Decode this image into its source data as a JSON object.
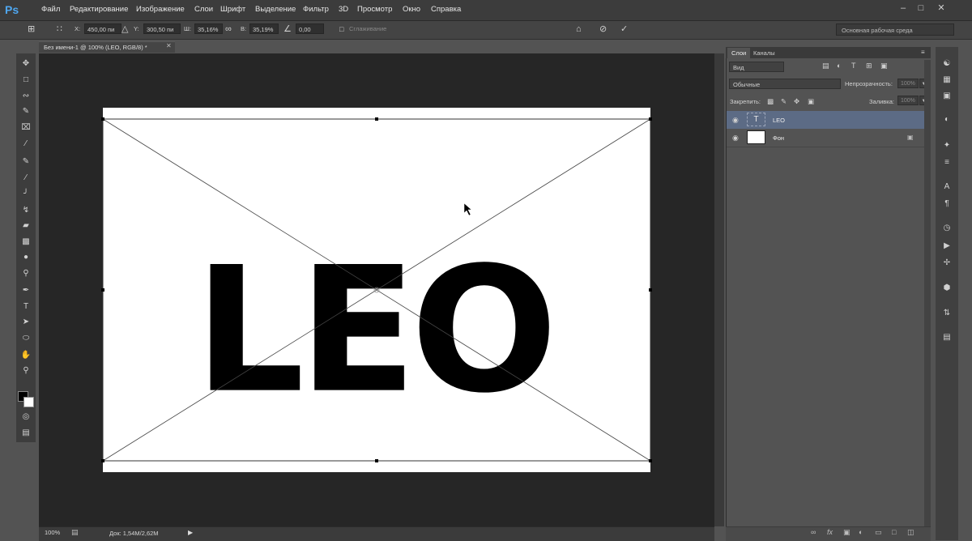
{
  "app": {
    "logo": "Ps",
    "menu": [
      "Файл",
      "Редактирование",
      "Изображение",
      "Слои",
      "Шрифт",
      "Выделение",
      "Фильтр",
      "3D",
      "Просмотр",
      "Окно",
      "Справка"
    ]
  },
  "options_bar": {
    "x_label": "X:",
    "x_value": "450,00 пи",
    "y_label": "Y:",
    "y_value": "300,50 пи",
    "w_label": "Ш:",
    "w_value": "35,16%",
    "h_label": "В:",
    "h_value": "35,19%",
    "angle_value": "0,00",
    "interp_label": "Сглаживание",
    "workspace": "Основная рабочая среда"
  },
  "document": {
    "tab_title": "Без имени-1 @ 100% (LEO, RGB/8) *",
    "text": "LEO"
  },
  "status_bar": {
    "zoom": "100%",
    "doc_size": "Док: 1,54M/2,62M"
  },
  "layers_panel": {
    "tab_layers": "Слои",
    "tab_channels": "Каналы",
    "filter": "Вид",
    "blend_mode": "Обычные",
    "opacity_label": "Непрозрачность:",
    "opacity_value": "100%",
    "lock_label": "Закрепить:",
    "fill_label": "Заливка:",
    "fill_value": "100%",
    "layers": [
      {
        "name": "LEO",
        "type": "text",
        "selected": true
      },
      {
        "name": "Фон",
        "type": "background",
        "locked": true
      }
    ]
  },
  "colors": {
    "accent": "#5c6b85",
    "canvas_bg": "#262626"
  }
}
